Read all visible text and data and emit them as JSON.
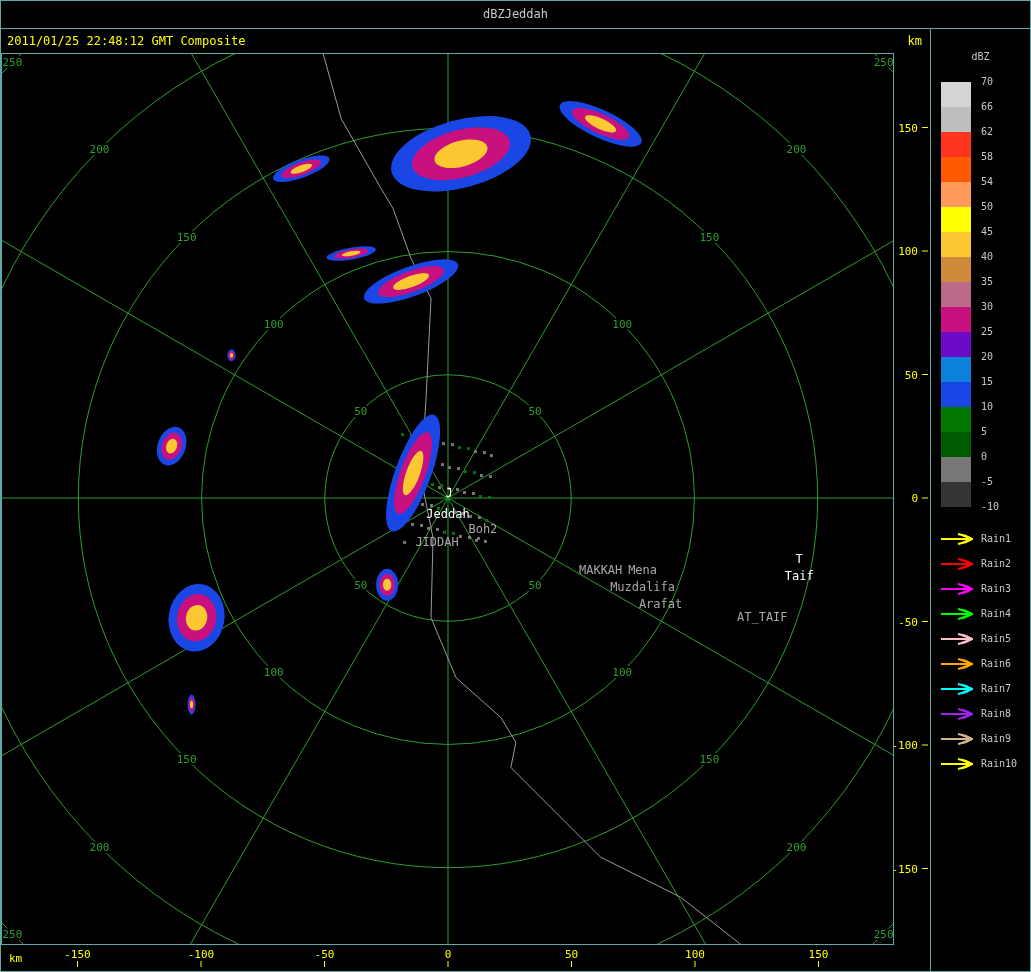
{
  "window": {
    "title": "dBZJeddah"
  },
  "header": {
    "timestamp": "2011/01/25 22:48:12 GMT Composite",
    "unit": "km"
  },
  "ring_labels": [
    {
      "range_labels": [
        "50",
        "50",
        "50",
        "50"
      ]
    },
    {
      "range_labels": [
        "100",
        "100",
        "100",
        "100"
      ]
    },
    {
      "range_labels": [
        "150",
        "150",
        "150",
        "150"
      ]
    },
    {
      "range_labels": [
        "200",
        "200",
        "200",
        "200"
      ]
    },
    {
      "range_labels": [
        "250",
        "250",
        "250",
        "250"
      ]
    }
  ],
  "places": [
    {
      "name": "J",
      "kind": "station"
    },
    {
      "name": "Jeddah",
      "kind": "station"
    },
    {
      "name": "Boh2",
      "kind": "place"
    },
    {
      "name": "JIDDAH",
      "kind": "place"
    },
    {
      "name": "MAKKAH",
      "kind": "place"
    },
    {
      "name": "Mena",
      "kind": "place"
    },
    {
      "name": "Muzdalifa",
      "kind": "place"
    },
    {
      "name": "Arafat",
      "kind": "place"
    },
    {
      "name": "AT_TAIF",
      "kind": "place"
    },
    {
      "name": "T",
      "kind": "station"
    },
    {
      "name": "Taif",
      "kind": "station"
    }
  ],
  "y_axis": {
    "ticks": [
      "150",
      "100",
      "50",
      "0",
      "-50",
      "-100",
      "-150"
    ]
  },
  "x_axis": {
    "unit": "km",
    "ticks": [
      "-150",
      "-100",
      "-50",
      "0",
      "50",
      "100",
      "150"
    ]
  },
  "legend": {
    "title": "dBZ",
    "bins": [
      {
        "color": "#d4d4d4"
      },
      {
        "color": "#bebebe"
      },
      {
        "color": "#ff3520"
      },
      {
        "color": "#ff5a00"
      },
      {
        "color": "#ff9a5a"
      },
      {
        "color": "#ffff00"
      },
      {
        "color": "#fbc832"
      },
      {
        "color": "#d08a3c"
      },
      {
        "color": "#bc6a8a"
      },
      {
        "color": "#c8107f"
      },
      {
        "color": "#6c0ac8"
      },
      {
        "color": "#0a82dc"
      },
      {
        "color": "#1a46e6"
      },
      {
        "color": "#007800"
      },
      {
        "color": "#005a00"
      },
      {
        "color": "#787878"
      },
      {
        "color": "#343434"
      }
    ],
    "labels": [
      "70",
      "66",
      "62",
      "58",
      "54",
      "50",
      "45",
      "40",
      "35",
      "30",
      "25",
      "20",
      "15",
      "10",
      "5",
      "0",
      "-5",
      "-10"
    ]
  },
  "tracks": [
    {
      "label": "Rain1",
      "color": "#ffff00"
    },
    {
      "label": "Rain2",
      "color": "#ff0000"
    },
    {
      "label": "Rain3",
      "color": "#ff00ff"
    },
    {
      "label": "Rain4",
      "color": "#00ff00"
    },
    {
      "label": "Rain5",
      "color": "#ffc0cb"
    },
    {
      "label": "Rain6",
      "color": "#ffa500"
    },
    {
      "label": "Rain7",
      "color": "#00ffff"
    },
    {
      "label": "Rain8",
      "color": "#a020f0"
    },
    {
      "label": "Rain9",
      "color": "#d2b48c"
    },
    {
      "label": "Rain10",
      "color": "#ffff00"
    }
  ]
}
